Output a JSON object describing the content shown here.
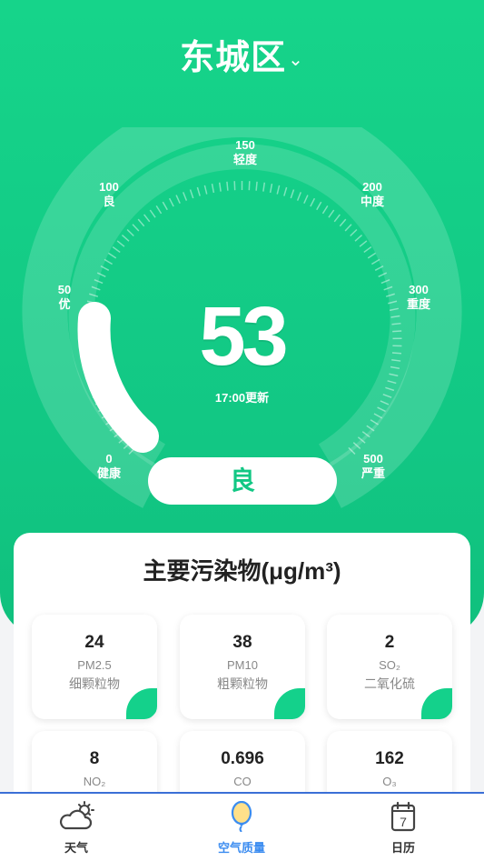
{
  "header": {
    "district": "东城区",
    "caret_icon": "chevron-down-icon"
  },
  "gauge": {
    "aqi": "53",
    "update_time": "17:00更新",
    "level": "良",
    "scale": [
      {
        "value": "0",
        "label": "健康"
      },
      {
        "value": "50",
        "label": "优"
      },
      {
        "value": "100",
        "label": "良"
      },
      {
        "value": "150",
        "label": "轻度"
      },
      {
        "value": "200",
        "label": "中度"
      },
      {
        "value": "300",
        "label": "重度"
      },
      {
        "value": "500",
        "label": "严重"
      }
    ],
    "colors": {
      "background": "#14d18b",
      "accent": "#ffffff"
    }
  },
  "pollutants": {
    "title": "主要污染物(μg/m³)",
    "items": [
      {
        "value": "24",
        "code": "PM2.5",
        "name": "细颗粒物"
      },
      {
        "value": "38",
        "code": "PM10",
        "name": "粗颗粒物"
      },
      {
        "value": "2",
        "code": "SO₂",
        "name": "二氧化硫"
      },
      {
        "value": "8",
        "code": "NO₂",
        "name": ""
      },
      {
        "value": "0.696",
        "code": "CO",
        "name": ""
      },
      {
        "value": "162",
        "code": "O₃",
        "name": ""
      }
    ]
  },
  "nav": {
    "items": [
      {
        "label": "天气",
        "icon": "cloud-sun-icon"
      },
      {
        "label": "空气质量",
        "icon": "balloon-icon"
      },
      {
        "label": "日历",
        "icon": "calendar-icon"
      }
    ],
    "calendar_day": "7",
    "active_color": "#3b8cf0"
  }
}
